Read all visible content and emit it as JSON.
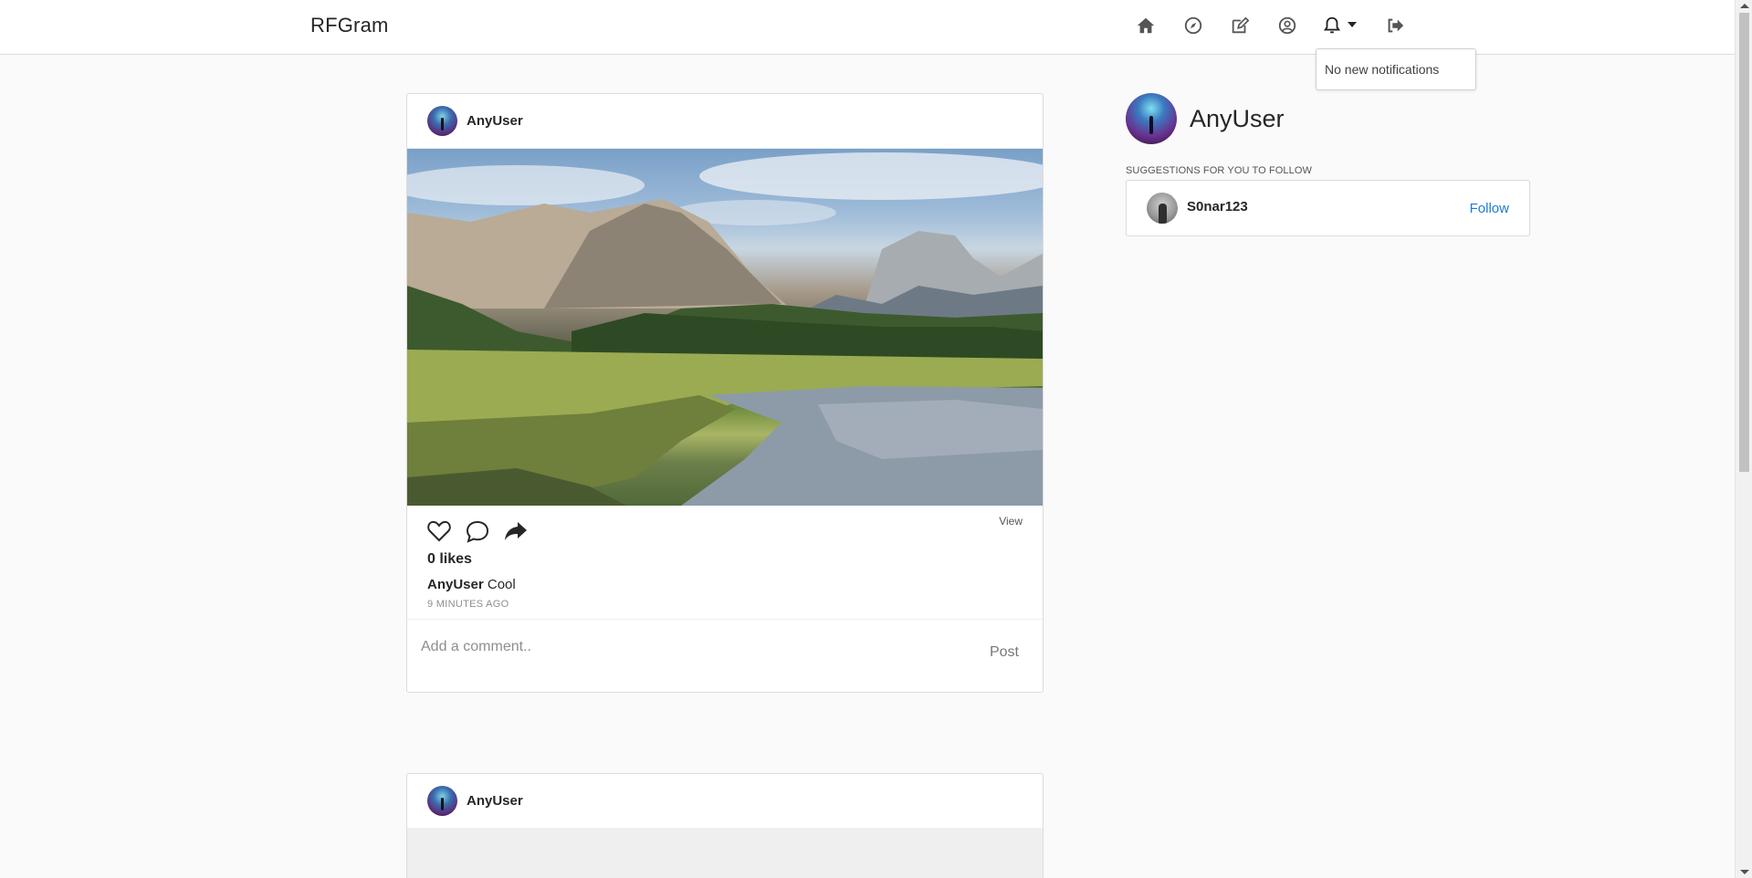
{
  "app": {
    "brand": "RFGram"
  },
  "nav": {
    "icons": [
      "home-icon",
      "explore-icon",
      "new-post-icon",
      "profile-icon",
      "notifications-icon",
      "logout-icon"
    ],
    "notifications_text": "No new notifications"
  },
  "posts": [
    {
      "username": "AnyUser",
      "view_label": "View",
      "likes": "0 likes",
      "caption_user": "AnyUser",
      "caption_text": "Cool",
      "timestamp": "9 MINUTES AGO",
      "comment_placeholder": "Add a comment..",
      "post_label": "Post"
    },
    {
      "username": "AnyUser"
    }
  ],
  "sidebar": {
    "username": "AnyUser",
    "suggestions_title": "SUGGESTIONS FOR YOU TO FOLLOW",
    "suggestions": [
      {
        "username": "S0nar123",
        "follow_label": "Follow"
      }
    ]
  },
  "colors": {
    "accent": "#1f7ad6",
    "border": "#dbdbdb",
    "background": "#fafafa"
  }
}
